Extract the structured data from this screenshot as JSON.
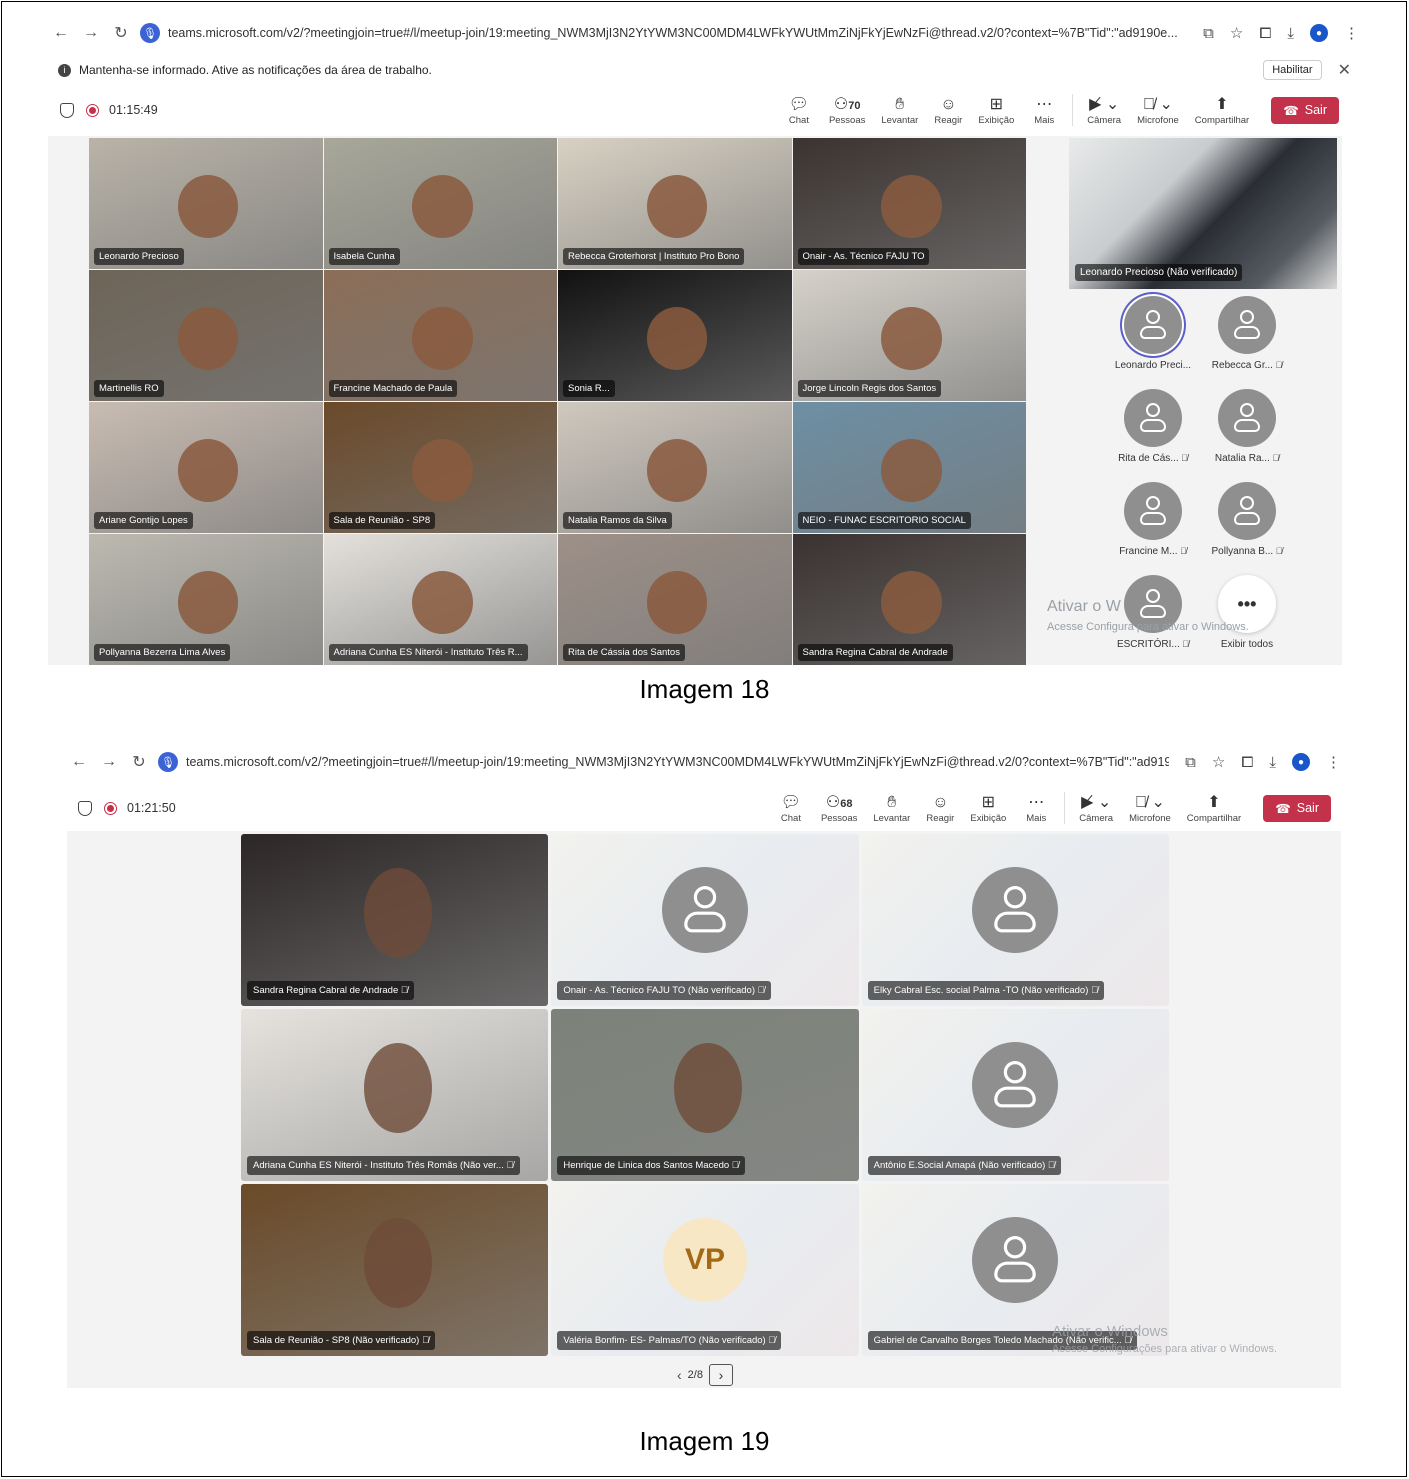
{
  "browser": {
    "url": "teams.microsoft.com/v2/?meetingjoin=true#/l/meetup-join/19:meeting_NWM3MjI3N2YtYWM3NC00MDM4LWFkYWUtMmZiNjFkYjEwNzFi@thread.v2/0?context=%7B\"Tid\":\"ad9190e..."
  },
  "notification": {
    "text": "Mantenha-se informado. Ative as notificações da área de trabalho.",
    "button": "Habilitar"
  },
  "controls": {
    "chat": "Chat",
    "people": "Pessoas",
    "raise": "Levantar",
    "react": "Reagir",
    "view": "Exibição",
    "more": "Mais",
    "camera": "Câmera",
    "mic": "Microfone",
    "share": "Compartilhar",
    "leave": "Sair"
  },
  "screen1": {
    "timer": "01:15:49",
    "people_count": "70",
    "caption": "Imagem 18",
    "tiles": [
      {
        "name": "Leonardo Precioso",
        "bg": "#b9b3a8"
      },
      {
        "name": "Isabela Cunha",
        "bg": "#a8a79a"
      },
      {
        "name": "Rebecca Groterhorst | Instituto Pro Bono",
        "bg": "#d8d1c3"
      },
      {
        "name": "Onair - As. Técnico FAJU TO",
        "bg": "#3b3330"
      },
      {
        "name": "Martinellis RO",
        "bg": "#6e6558"
      },
      {
        "name": "Francine Machado de Paula",
        "bg": "#8b6e58"
      },
      {
        "name": "Sonia R...",
        "bg": "#111111"
      },
      {
        "name": "Jorge Lincoln Regis dos Santos",
        "bg": "#d6d2ca"
      },
      {
        "name": "Ariane Gontijo Lopes",
        "bg": "#c8bcb2"
      },
      {
        "name": "Sala de Reunião - SP8",
        "bg": "#6b4a2a"
      },
      {
        "name": "Natalia Ramos da Silva",
        "bg": "#cfc8be"
      },
      {
        "name": "NEIO - FUNAC ESCRITORIO SOCIAL",
        "bg": "#6d8fa4"
      },
      {
        "name": "Pollyanna Bezerra Lima Alves",
        "bg": "#bcb9b0"
      },
      {
        "name": "Adriana Cunha ES Niterói - Instituto Três R...",
        "bg": "#e4e1dc"
      },
      {
        "name": "Rita de Cássia dos Santos",
        "bg": "#9d9088"
      },
      {
        "name": "Sandra Regina Cabral de Andrade",
        "bg": "#3a3230"
      }
    ],
    "spotlight": "Leonardo Precioso (Não verificado)",
    "roster": [
      "Leonardo Preci...",
      "Rebecca Gr...",
      "Rita de Cás...",
      "Natalia Ra...",
      "Francine M...",
      "Pollyanna B...",
      "ESCRITÓRI...",
      "Exibir todos"
    ],
    "watermark_title": "Ativar o W",
    "watermark_sub": "Acesse Configura         para ativar o Windows."
  },
  "screen2": {
    "timer": "01:21:50",
    "people_count": "68",
    "caption": "Imagem 19",
    "pager": "2/8",
    "tiles": [
      {
        "name": "Sandra Regina Cabral de Andrade",
        "type": "video",
        "bg": "#2c2626"
      },
      {
        "name": "Onair - As. Técnico FAJU TO (Não verificado)",
        "type": "avatar"
      },
      {
        "name": "Elky Cabral Esc. social Palma -TO (Não verificado)",
        "type": "avatar"
      },
      {
        "name": "Adriana Cunha ES Niterói - Instituto Três Romãs (Não ver...",
        "type": "video",
        "bg": "#e6e3de"
      },
      {
        "name": "Henrique de Linica dos Santos Macedo",
        "type": "video",
        "bg": "#7c8279"
      },
      {
        "name": "Antônio E.Social Amapá (Não verificado)",
        "type": "avatar"
      },
      {
        "name": "Sala de Reunião - SP8 (Não verificado)",
        "type": "video",
        "bg": "#6a4a28"
      },
      {
        "name": "Valéria Bonfim- ES- Palmas/TO (Não verificado)",
        "type": "initials",
        "initials": "VP"
      },
      {
        "name": "Gabriel de Carvalho Borges Toledo Machado (Não verific...",
        "type": "avatar"
      }
    ],
    "watermark_title": "Ativar o Windows",
    "watermark_sub": "Acesse Configurações para ativar o Windows."
  }
}
